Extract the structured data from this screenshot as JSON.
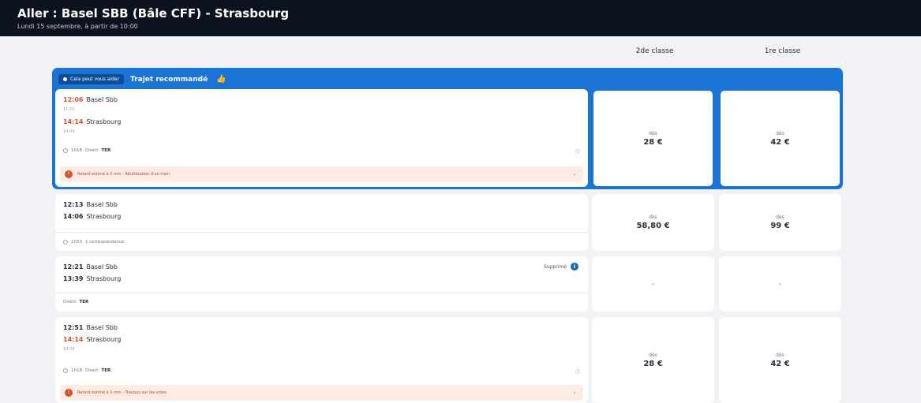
{
  "header": {
    "title": "Aller : Basel SBB (Bâle CFF) - Strasbourg",
    "subtitle": "Lundi 15 septembre, à partir de 10:00"
  },
  "columns": {
    "second": "2de classe",
    "first": "1re classe"
  },
  "recommended": {
    "pill": "Cela peut vous aider",
    "label": "Trajet recommandé"
  },
  "trips": [
    {
      "dep_time": "12:06",
      "dep_station": "Basel Sbb",
      "dep_sched": "11:55",
      "arr_time": "14:14",
      "arr_station": "Strasbourg",
      "arr_sched": "14:04",
      "duration": "1h18",
      "mode": "Direct",
      "train": "TER",
      "expand": "ⓘ",
      "alert": "Retard estimé à 5 min - Réutilisation d'un train",
      "price_from": "dès",
      "price_2nd": "28 €",
      "price_1st": "42 €"
    },
    {
      "dep_time": "12:13",
      "dep_station": "Basel Sbb",
      "arr_time": "14:06",
      "arr_station": "Strasbourg",
      "duration": "1h53",
      "mode": "1 correspondance",
      "price_from": "dès",
      "price_2nd": "58,80 €",
      "price_1st": "99 €"
    },
    {
      "dep_time": "12:21",
      "dep_station": "Basel Sbb",
      "arr_time": "13:39",
      "arr_station": "Strasbourg",
      "status": "Supprimé",
      "mode": "Direct",
      "train": "TER",
      "price_2nd": "-",
      "price_1st": "-"
    },
    {
      "dep_time": "12:51",
      "dep_station": "Basel Sbb",
      "arr_time": "14:14",
      "arr_station": "Strasbourg",
      "arr_sched": "14:09",
      "duration": "1h18",
      "mode": "Direct",
      "train": "TER",
      "expand": "ⓘ",
      "alert": "Retard estimé à 5 min - Travaux sur les voies",
      "price_from": "dès",
      "price_2nd": "28 €",
      "price_1st": "42 €"
    }
  ],
  "colors": {
    "accent": "#1a74d6",
    "late": "#d4532b",
    "topbar": "#0c131f"
  }
}
